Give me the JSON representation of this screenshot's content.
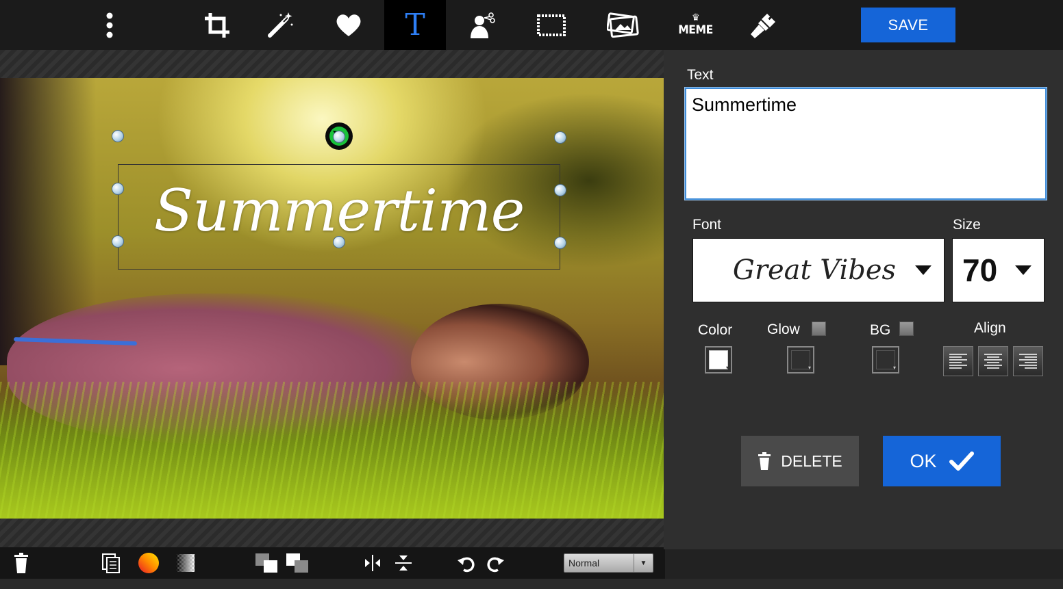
{
  "toolbar": {
    "tools": [
      {
        "name": "more-options",
        "icon": "vertical-dots-icon"
      },
      {
        "name": "crop",
        "icon": "crop-icon"
      },
      {
        "name": "effects",
        "icon": "magic-wand-icon"
      },
      {
        "name": "stickers",
        "icon": "heart-icon"
      },
      {
        "name": "text",
        "icon": "text-icon",
        "glyph": "T",
        "active": true
      },
      {
        "name": "cutout",
        "icon": "person-scissors-icon"
      },
      {
        "name": "frames",
        "icon": "frame-icon"
      },
      {
        "name": "overlay",
        "icon": "photo-overlay-icon"
      },
      {
        "name": "meme",
        "icon": "meme-crown-icon",
        "label": "MEME"
      },
      {
        "name": "draw",
        "icon": "brush-icon"
      }
    ],
    "save_label": "SAVE",
    "accent_color": "#1565d8",
    "active_color": "#2e7ff5"
  },
  "canvas": {
    "overlay_text": "Summertime",
    "rotate_icon": "rotate-icon"
  },
  "bottom_toolbar": {
    "items": [
      "trash-icon",
      "duplicate-icon",
      "color-gradient-icon",
      "transparency-icon",
      "bring-forward-icon",
      "send-backward-icon",
      "flip-horizontal-icon",
      "flip-vertical-icon",
      "undo-icon",
      "redo-icon"
    ],
    "blend_mode": "Normal"
  },
  "panel": {
    "text_label": "Text",
    "text_value": "Summertime",
    "font_label": "Font",
    "font_value": "Great Vibes",
    "size_label": "Size",
    "size_value": "70",
    "color_label": "Color",
    "glow_label": "Glow",
    "bg_label": "BG",
    "align_label": "Align",
    "text_color": "#ffffff",
    "delete_label": "DELETE",
    "ok_label": "OK"
  }
}
